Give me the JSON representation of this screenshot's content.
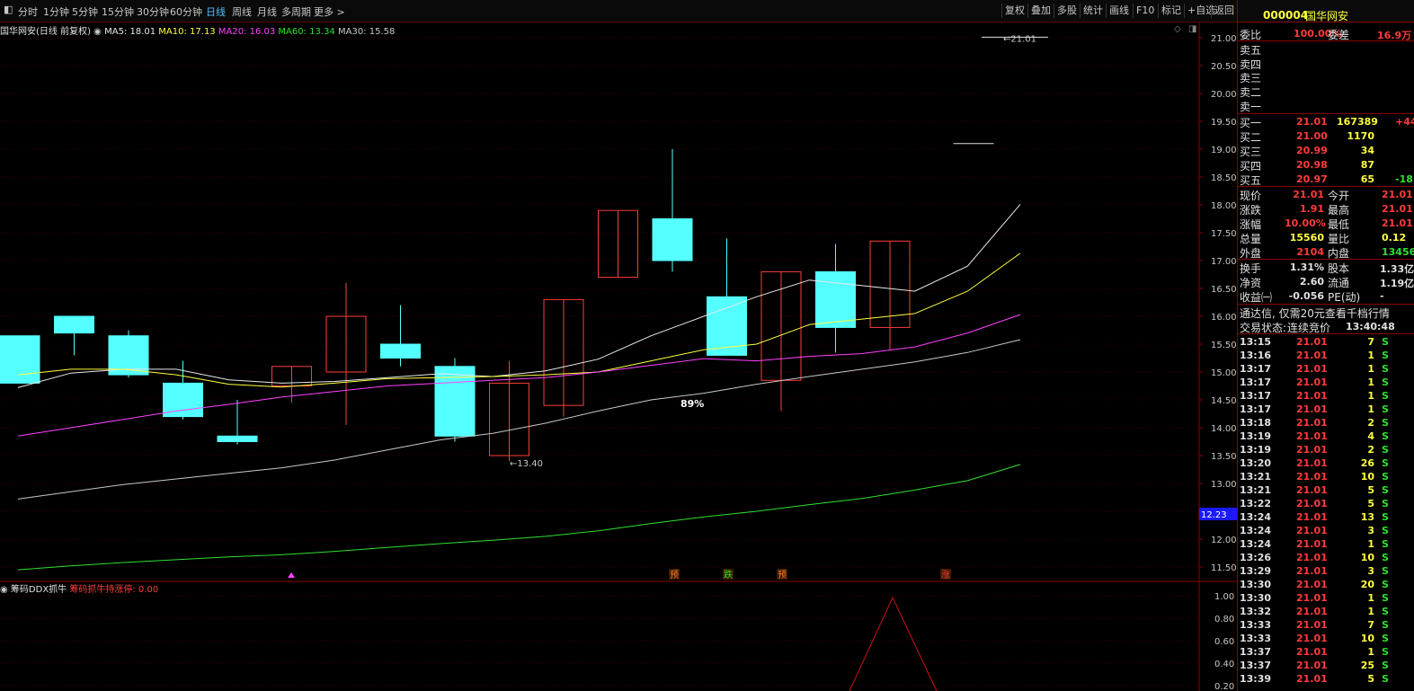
{
  "toolbar": {
    "periods": [
      "分时",
      "1分钟",
      "5分钟",
      "15分钟",
      "30分钟",
      "60分钟",
      "日线",
      "周线",
      "月线",
      "多周期",
      "更多 >"
    ],
    "active_period": "日线",
    "right_buttons": [
      "复权",
      "叠加",
      "多股",
      "统计",
      "画线",
      "F10",
      "标记",
      "+自选",
      "返回"
    ]
  },
  "info": {
    "stock_name": "国华网安",
    "mode": "(日线 前复权)",
    "ma5": "MA5: 18.01",
    "ma10": "MA10: 17.13",
    "ma20": "MA20: 16.03",
    "ma60": "MA60: 13.34",
    "ma30": "MA30: 15.58"
  },
  "indicator": {
    "name": "筹码DDX抓牛",
    "sub": "筹码抓牛持涨停: 0.00"
  },
  "annotations": {
    "high_label": "21.01",
    "low_label": "13.40",
    "percent": "89%",
    "signals": [
      "预",
      "跌",
      "预",
      "涨"
    ],
    "current_price_tag": "12.23"
  },
  "price_axis": [
    "21.00",
    "20.50",
    "20.00",
    "19.50",
    "19.00",
    "18.50",
    "18.00",
    "17.50",
    "17.00",
    "16.50",
    "16.00",
    "15.50",
    "15.00",
    "14.50",
    "14.00",
    "13.50",
    "13.00",
    "12.50",
    "12.00",
    "11.50"
  ],
  "ind_axis": [
    "1.00",
    "0.80",
    "0.60",
    "0.40",
    "0.20"
  ],
  "chart_data": {
    "type": "candlestick",
    "candles": [
      {
        "o": 15.65,
        "c": 14.8,
        "h": 15.65,
        "l": 14.8
      },
      {
        "o": 16.0,
        "c": 15.7,
        "h": 16.0,
        "l": 15.3
      },
      {
        "o": 15.65,
        "c": 14.95,
        "h": 15.75,
        "l": 14.9
      },
      {
        "o": 14.8,
        "c": 14.2,
        "h": 15.2,
        "l": 14.15
      },
      {
        "o": 13.85,
        "c": 13.75,
        "h": 14.5,
        "l": 13.7
      },
      {
        "o": 14.75,
        "c": 15.1,
        "h": 15.1,
        "l": 14.45
      },
      {
        "o": 15.0,
        "c": 16.0,
        "h": 16.6,
        "l": 14.05
      },
      {
        "o": 15.5,
        "c": 15.25,
        "h": 16.2,
        "l": 15.1
      },
      {
        "o": 15.1,
        "c": 13.85,
        "h": 15.25,
        "l": 13.75
      },
      {
        "o": 13.5,
        "c": 14.8,
        "h": 15.2,
        "l": 13.4
      },
      {
        "o": 14.4,
        "c": 16.3,
        "h": 16.3,
        "l": 14.2
      },
      {
        "o": 16.7,
        "c": 17.9,
        "h": 17.9,
        "l": 16.7
      },
      {
        "o": 17.75,
        "c": 17.0,
        "h": 19.0,
        "l": 16.8
      },
      {
        "o": 16.35,
        "c": 15.3,
        "h": 17.4,
        "l": 15.3
      },
      {
        "o": 14.85,
        "c": 16.8,
        "h": 16.8,
        "l": 14.3
      },
      {
        "o": 16.8,
        "c": 15.8,
        "h": 17.3,
        "l": 15.35
      },
      {
        "o": 15.8,
        "c": 17.35,
        "h": 17.35,
        "l": 15.4
      },
      {
        "o": 19.1,
        "c": 19.1,
        "h": 19.1,
        "l": 19.1
      },
      {
        "o": 21.01,
        "c": 21.01,
        "h": 21.01,
        "l": 21.01
      }
    ],
    "ma5": [
      14.72,
      14.98,
      15.05,
      15.05,
      14.86,
      14.8,
      14.83,
      14.9,
      14.97,
      14.92,
      15.02,
      15.23,
      15.65,
      16.0,
      16.35,
      16.65,
      16.55,
      16.45,
      16.9,
      18.01
    ],
    "ma10": [
      14.95,
      15.05,
      15.05,
      14.95,
      14.78,
      14.73,
      14.8,
      14.88,
      14.9,
      14.92,
      14.95,
      15.0,
      15.2,
      15.4,
      15.5,
      15.85,
      15.95,
      16.05,
      16.45,
      17.13
    ],
    "ma20": [
      13.85,
      14.0,
      14.15,
      14.3,
      14.42,
      14.55,
      14.65,
      14.75,
      14.8,
      14.85,
      14.9,
      15.0,
      15.12,
      15.24,
      15.2,
      15.28,
      15.33,
      15.45,
      15.7,
      16.03
    ],
    "ma30": [
      12.72,
      12.85,
      12.98,
      13.08,
      13.18,
      13.28,
      13.42,
      13.6,
      13.78,
      13.9,
      14.08,
      14.3,
      14.5,
      14.62,
      14.78,
      14.92,
      15.05,
      15.18,
      15.35,
      15.58
    ],
    "ma60": [
      11.45,
      11.52,
      11.58,
      11.63,
      11.68,
      11.72,
      11.78,
      11.85,
      11.92,
      11.98,
      12.05,
      12.15,
      12.28,
      12.4,
      12.5,
      12.62,
      12.73,
      12.88,
      13.05,
      13.34
    ]
  },
  "side": {
    "code": "000004",
    "name": "国华网安",
    "weibi_label": "委比",
    "weibi": "100.00%",
    "weicha_label": "委差",
    "weicha": "16.9万",
    "sells": [
      "卖五",
      "卖四",
      "卖三",
      "卖二",
      "卖一"
    ],
    "buys": [
      {
        "label": "买一",
        "price": "21.01",
        "vol": "167389",
        "chg": "+44"
      },
      {
        "label": "买二",
        "price": "21.00",
        "vol": "1170",
        "chg": ""
      },
      {
        "label": "买三",
        "price": "20.99",
        "vol": "34",
        "chg": ""
      },
      {
        "label": "买四",
        "price": "20.98",
        "vol": "87",
        "chg": ""
      },
      {
        "label": "买五",
        "price": "20.97",
        "vol": "65",
        "chg": "-18"
      }
    ],
    "stats": [
      {
        "l1": "现价",
        "v1": "21.01",
        "l2": "今开",
        "v2": "21.01",
        "c1": "red",
        "c2": "red"
      },
      {
        "l1": "涨跌",
        "v1": "1.91",
        "l2": "最高",
        "v2": "21.01",
        "c1": "red",
        "c2": "red"
      },
      {
        "l1": "涨幅",
        "v1": "10.00%",
        "l2": "最低",
        "v2": "21.01",
        "c1": "red",
        "c2": "red"
      },
      {
        "l1": "总量",
        "v1": "15560",
        "l2": "量比",
        "v2": "0.12",
        "c1": "yel",
        "c2": "yel"
      },
      {
        "l1": "外盘",
        "v1": "2104",
        "l2": "内盘",
        "v2": "13456",
        "c1": "red",
        "c2": "grn"
      }
    ],
    "stats2": [
      {
        "l1": "换手",
        "v1": "1.31%",
        "l2": "股本",
        "v2": "1.33亿"
      },
      {
        "l1": "净资",
        "v1": "2.60",
        "l2": "流通",
        "v2": "1.19亿"
      },
      {
        "l1": "收益㈠",
        "v1": "-0.056",
        "l2": "PE(动)",
        "v2": "-"
      }
    ],
    "promo": "通达信, 仅需20元查看千档行情",
    "trade_state_label": "交易状态:",
    "trade_state": "连续竞价",
    "trade_time": "13:40:48",
    "ticks": [
      [
        "13:15",
        "21.01",
        "7",
        "S"
      ],
      [
        "13:16",
        "21.01",
        "1",
        "S"
      ],
      [
        "13:17",
        "21.01",
        "1",
        "S"
      ],
      [
        "13:17",
        "21.01",
        "1",
        "S"
      ],
      [
        "13:17",
        "21.01",
        "1",
        "S"
      ],
      [
        "13:17",
        "21.01",
        "1",
        "S"
      ],
      [
        "13:18",
        "21.01",
        "2",
        "S"
      ],
      [
        "13:19",
        "21.01",
        "4",
        "S"
      ],
      [
        "13:19",
        "21.01",
        "2",
        "S"
      ],
      [
        "13:20",
        "21.01",
        "26",
        "S"
      ],
      [
        "13:21",
        "21.01",
        "10",
        "S"
      ],
      [
        "13:21",
        "21.01",
        "5",
        "S"
      ],
      [
        "13:22",
        "21.01",
        "5",
        "S"
      ],
      [
        "13:24",
        "21.01",
        "13",
        "S"
      ],
      [
        "13:24",
        "21.01",
        "3",
        "S"
      ],
      [
        "13:24",
        "21.01",
        "1",
        "S"
      ],
      [
        "13:26",
        "21.01",
        "10",
        "S"
      ],
      [
        "13:29",
        "21.01",
        "3",
        "S"
      ],
      [
        "13:30",
        "21.01",
        "20",
        "S"
      ],
      [
        "13:30",
        "21.01",
        "1",
        "S"
      ],
      [
        "13:32",
        "21.01",
        "1",
        "S"
      ],
      [
        "13:33",
        "21.01",
        "7",
        "S"
      ],
      [
        "13:33",
        "21.01",
        "10",
        "S"
      ],
      [
        "13:37",
        "21.01",
        "1",
        "S"
      ],
      [
        "13:37",
        "21.01",
        "25",
        "S"
      ],
      [
        "13:39",
        "21.01",
        "5",
        "S"
      ]
    ]
  }
}
